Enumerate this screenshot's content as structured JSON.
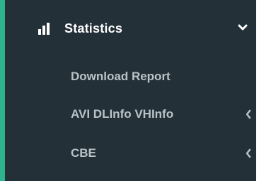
{
  "menu": {
    "title": "Statistics",
    "icon": "bar-chart-icon",
    "expanded_icon": "chevron-down-icon",
    "items": [
      {
        "label": "Download Report",
        "has_children": false
      },
      {
        "label": "AVI DLInfo VHInfo",
        "has_children": true,
        "icon": "chevron-left-icon"
      },
      {
        "label": "CBE",
        "has_children": true,
        "icon": "chevron-left-icon"
      }
    ]
  },
  "colors": {
    "sidebar_background": "#243038",
    "accent": "#2fb38e",
    "header_text": "#ffffff",
    "item_text": "#b8c2c7"
  }
}
